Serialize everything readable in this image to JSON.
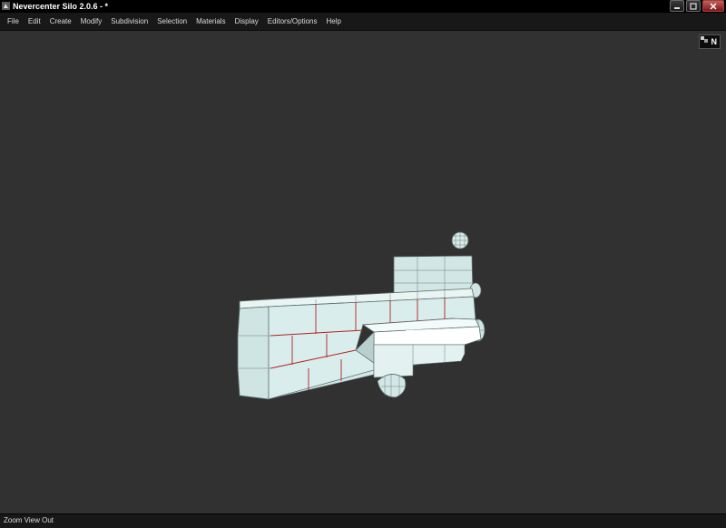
{
  "window": {
    "title": "Nevercenter Silo 2.0.6 - *"
  },
  "menu": {
    "items": [
      "File",
      "Edit",
      "Create",
      "Modify",
      "Subdivision",
      "Selection",
      "Materials",
      "Display",
      "Editors/Options",
      "Help"
    ]
  },
  "viewport": {
    "nav_cube_label": "N",
    "colors": {
      "background": "#313131",
      "mesh_face": "#d6ecea",
      "mesh_edge": "#5a6b6b",
      "selected_edge": "#b02020"
    }
  },
  "status": {
    "text": "Zoom View Out"
  },
  "icons": [
    "silo-app-icon",
    "minimize-icon",
    "maximize-icon",
    "close-icon"
  ]
}
